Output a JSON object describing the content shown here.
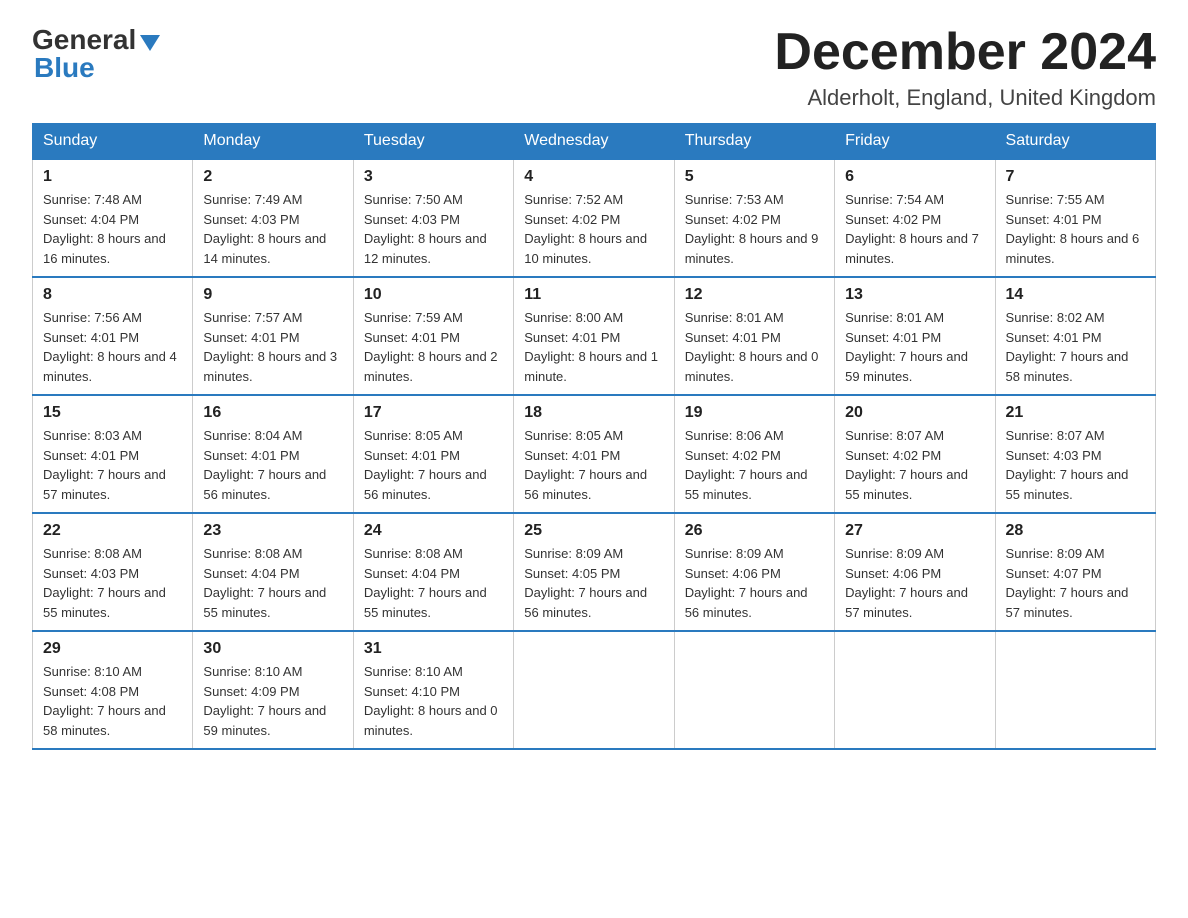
{
  "logo": {
    "general": "General",
    "blue": "Blue"
  },
  "title": "December 2024",
  "location": "Alderholt, England, United Kingdom",
  "days_of_week": [
    "Sunday",
    "Monday",
    "Tuesday",
    "Wednesday",
    "Thursday",
    "Friday",
    "Saturday"
  ],
  "weeks": [
    [
      {
        "day": "1",
        "sunrise": "7:48 AM",
        "sunset": "4:04 PM",
        "daylight": "8 hours and 16 minutes."
      },
      {
        "day": "2",
        "sunrise": "7:49 AM",
        "sunset": "4:03 PM",
        "daylight": "8 hours and 14 minutes."
      },
      {
        "day": "3",
        "sunrise": "7:50 AM",
        "sunset": "4:03 PM",
        "daylight": "8 hours and 12 minutes."
      },
      {
        "day": "4",
        "sunrise": "7:52 AM",
        "sunset": "4:02 PM",
        "daylight": "8 hours and 10 minutes."
      },
      {
        "day": "5",
        "sunrise": "7:53 AM",
        "sunset": "4:02 PM",
        "daylight": "8 hours and 9 minutes."
      },
      {
        "day": "6",
        "sunrise": "7:54 AM",
        "sunset": "4:02 PM",
        "daylight": "8 hours and 7 minutes."
      },
      {
        "day": "7",
        "sunrise": "7:55 AM",
        "sunset": "4:01 PM",
        "daylight": "8 hours and 6 minutes."
      }
    ],
    [
      {
        "day": "8",
        "sunrise": "7:56 AM",
        "sunset": "4:01 PM",
        "daylight": "8 hours and 4 minutes."
      },
      {
        "day": "9",
        "sunrise": "7:57 AM",
        "sunset": "4:01 PM",
        "daylight": "8 hours and 3 minutes."
      },
      {
        "day": "10",
        "sunrise": "7:59 AM",
        "sunset": "4:01 PM",
        "daylight": "8 hours and 2 minutes."
      },
      {
        "day": "11",
        "sunrise": "8:00 AM",
        "sunset": "4:01 PM",
        "daylight": "8 hours and 1 minute."
      },
      {
        "day": "12",
        "sunrise": "8:01 AM",
        "sunset": "4:01 PM",
        "daylight": "8 hours and 0 minutes."
      },
      {
        "day": "13",
        "sunrise": "8:01 AM",
        "sunset": "4:01 PM",
        "daylight": "7 hours and 59 minutes."
      },
      {
        "day": "14",
        "sunrise": "8:02 AM",
        "sunset": "4:01 PM",
        "daylight": "7 hours and 58 minutes."
      }
    ],
    [
      {
        "day": "15",
        "sunrise": "8:03 AM",
        "sunset": "4:01 PM",
        "daylight": "7 hours and 57 minutes."
      },
      {
        "day": "16",
        "sunrise": "8:04 AM",
        "sunset": "4:01 PM",
        "daylight": "7 hours and 56 minutes."
      },
      {
        "day": "17",
        "sunrise": "8:05 AM",
        "sunset": "4:01 PM",
        "daylight": "7 hours and 56 minutes."
      },
      {
        "day": "18",
        "sunrise": "8:05 AM",
        "sunset": "4:01 PM",
        "daylight": "7 hours and 56 minutes."
      },
      {
        "day": "19",
        "sunrise": "8:06 AM",
        "sunset": "4:02 PM",
        "daylight": "7 hours and 55 minutes."
      },
      {
        "day": "20",
        "sunrise": "8:07 AM",
        "sunset": "4:02 PM",
        "daylight": "7 hours and 55 minutes."
      },
      {
        "day": "21",
        "sunrise": "8:07 AM",
        "sunset": "4:03 PM",
        "daylight": "7 hours and 55 minutes."
      }
    ],
    [
      {
        "day": "22",
        "sunrise": "8:08 AM",
        "sunset": "4:03 PM",
        "daylight": "7 hours and 55 minutes."
      },
      {
        "day": "23",
        "sunrise": "8:08 AM",
        "sunset": "4:04 PM",
        "daylight": "7 hours and 55 minutes."
      },
      {
        "day": "24",
        "sunrise": "8:08 AM",
        "sunset": "4:04 PM",
        "daylight": "7 hours and 55 minutes."
      },
      {
        "day": "25",
        "sunrise": "8:09 AM",
        "sunset": "4:05 PM",
        "daylight": "7 hours and 56 minutes."
      },
      {
        "day": "26",
        "sunrise": "8:09 AM",
        "sunset": "4:06 PM",
        "daylight": "7 hours and 56 minutes."
      },
      {
        "day": "27",
        "sunrise": "8:09 AM",
        "sunset": "4:06 PM",
        "daylight": "7 hours and 57 minutes."
      },
      {
        "day": "28",
        "sunrise": "8:09 AM",
        "sunset": "4:07 PM",
        "daylight": "7 hours and 57 minutes."
      }
    ],
    [
      {
        "day": "29",
        "sunrise": "8:10 AM",
        "sunset": "4:08 PM",
        "daylight": "7 hours and 58 minutes."
      },
      {
        "day": "30",
        "sunrise": "8:10 AM",
        "sunset": "4:09 PM",
        "daylight": "7 hours and 59 minutes."
      },
      {
        "day": "31",
        "sunrise": "8:10 AM",
        "sunset": "4:10 PM",
        "daylight": "8 hours and 0 minutes."
      },
      null,
      null,
      null,
      null
    ]
  ],
  "labels": {
    "sunrise_prefix": "Sunrise: ",
    "sunset_prefix": "Sunset: ",
    "daylight_prefix": "Daylight: "
  }
}
